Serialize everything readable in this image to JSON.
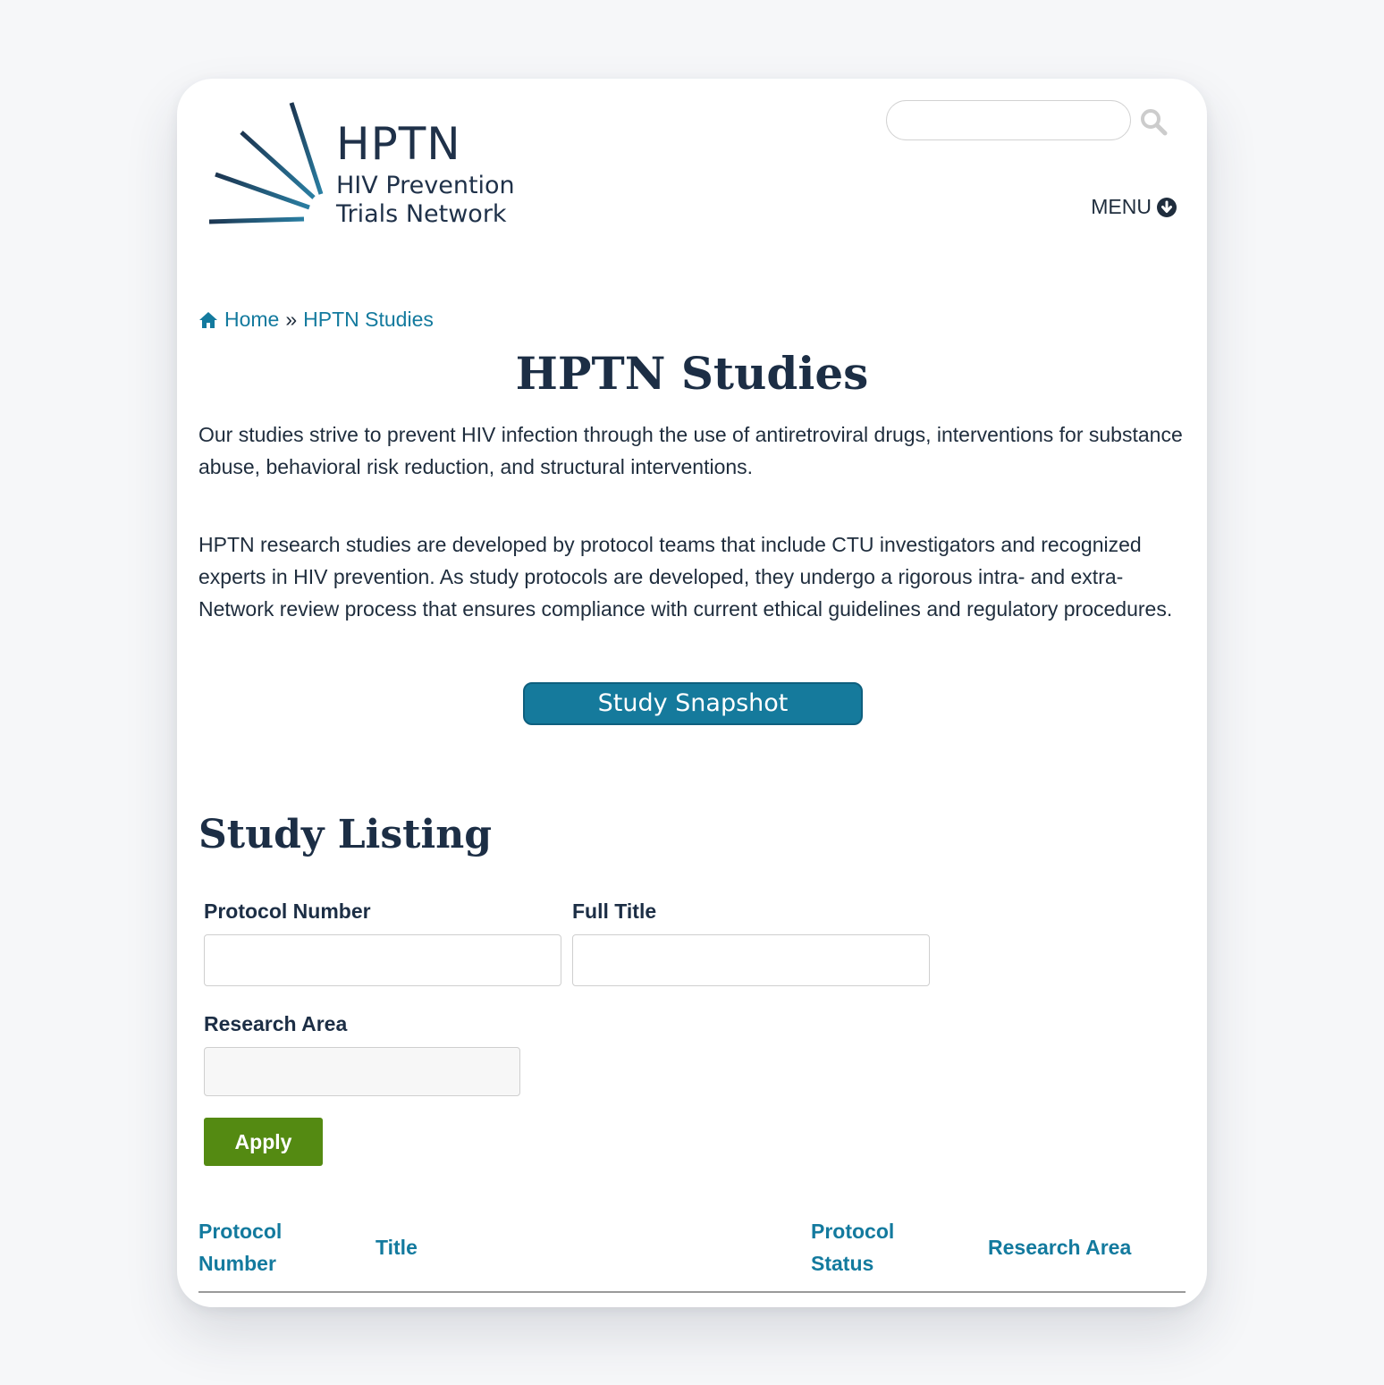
{
  "header": {
    "logo": {
      "abbreviation": "HPTN",
      "line1": "HIV Prevention",
      "line2": "Trials Network"
    },
    "search": {
      "placeholder": "",
      "value": ""
    },
    "menu_label": "MENU"
  },
  "breadcrumb": {
    "home": "Home",
    "separator": "»",
    "current": "HPTN Studies"
  },
  "page": {
    "title": "HPTN Studies",
    "intro_1": "Our studies strive to prevent HIV infection through the use of antiretroviral drugs, interventions for substance abuse, behavioral risk reduction, and structural interventions.",
    "intro_2": "HPTN research studies are developed by protocol teams that include CTU investigators and recognized experts in HIV prevention. As study protocols are developed, they undergo a rigorous intra- and extra-Network review process that ensures compliance with current ethical guidelines and regulatory procedures.",
    "snapshot_button": "Study Snapshot"
  },
  "listing": {
    "title": "Study Listing",
    "filters": {
      "protocol_number_label": "Protocol Number",
      "protocol_number_value": "",
      "full_title_label": "Full Title",
      "full_title_value": "",
      "research_area_label": "Research Area",
      "research_area_value": ""
    },
    "apply_label": "Apply",
    "columns": {
      "protocol_number_1": "Protocol",
      "protocol_number_2": "Number",
      "title": "Title",
      "protocol_status_1": "Protocol",
      "protocol_status_2": "Status",
      "research_area": "Research Area"
    }
  },
  "colors": {
    "brand_navy": "#1c2e45",
    "link_teal": "#137a9e",
    "apply_green": "#548a12",
    "snapshot_blue": "#157a9c"
  }
}
